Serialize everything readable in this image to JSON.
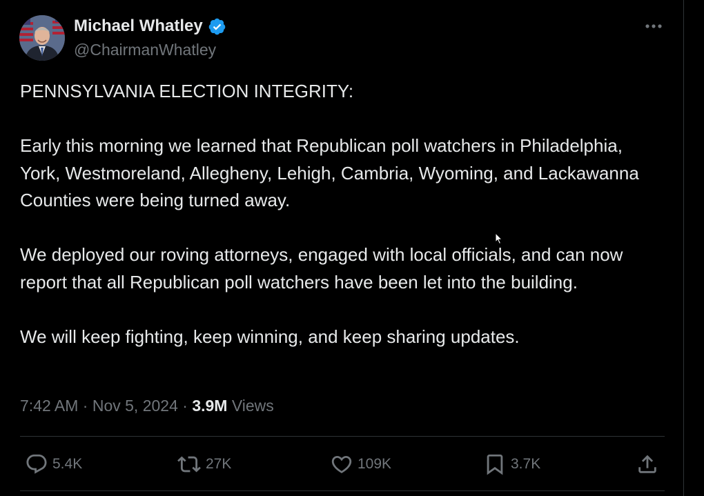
{
  "author": {
    "name": "Michael Whatley",
    "handle": "@ChairmanWhatley",
    "verified_icon": "verified-badge-icon",
    "verified_color": "#1d9bf0"
  },
  "menu": {
    "icon": "more-horizontal-icon"
  },
  "tweet": {
    "paragraphs": [
      "PENNSYLVANIA ELECTION INTEGRITY:",
      "Early this morning we learned that Republican poll watchers in Philadelphia, York, Westmoreland, Allegheny, Lehigh, Cambria, Wyoming, and Lackawanna Counties were being turned away.",
      "We deployed our roving attorneys, engaged with local officials, and can now report that all Republican poll watchers have been let into the building.",
      "We will keep fighting, keep winning, and keep sharing updates."
    ]
  },
  "meta": {
    "time": "7:42 AM",
    "separator": " · ",
    "date": "Nov 5, 2024",
    "separator2": " · ",
    "views_count": "3.9M",
    "views_label": " Views"
  },
  "actions": {
    "replies": {
      "icon": "reply-icon",
      "count": "5.4K"
    },
    "reposts": {
      "icon": "repost-icon",
      "count": "27K"
    },
    "likes": {
      "icon": "heart-icon",
      "count": "109K"
    },
    "bookmarks": {
      "icon": "bookmark-icon",
      "count": "3.7K"
    },
    "share": {
      "icon": "share-icon"
    }
  },
  "colors": {
    "background": "#000000",
    "text_primary": "#e7e9ea",
    "text_secondary": "#71767b",
    "divider": "#2f3336",
    "accent": "#1d9bf0"
  }
}
